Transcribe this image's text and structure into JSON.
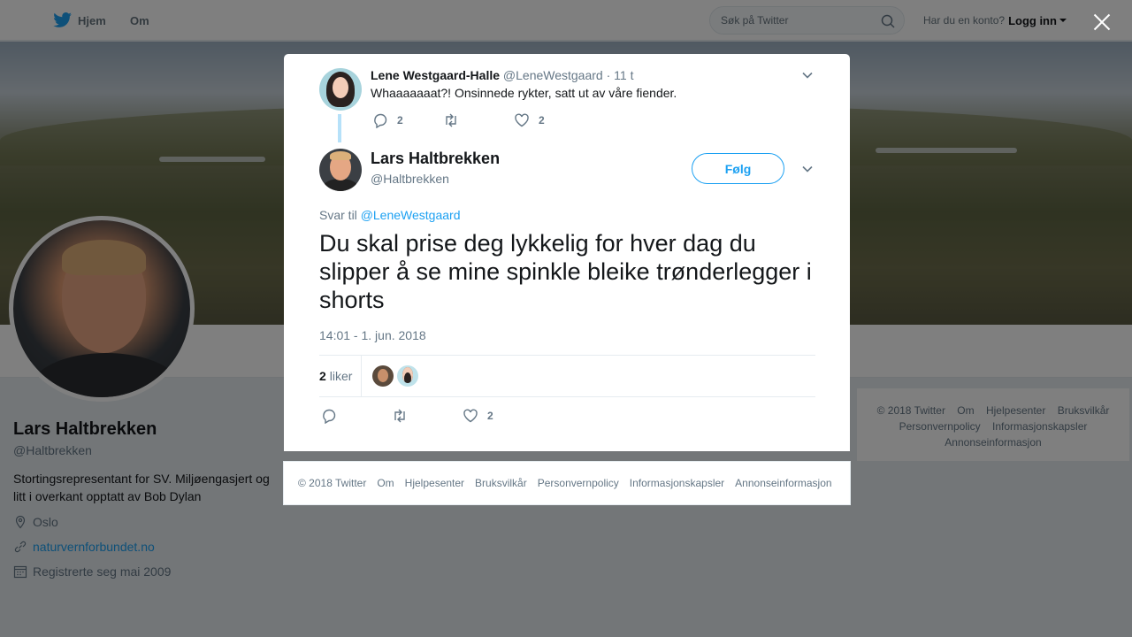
{
  "topnav": {
    "home_label": "Hjem",
    "about_label": "Om",
    "search_placeholder": "Søk på Twitter",
    "account_prompt": "Har du en konto?",
    "login_label": "Logg inn"
  },
  "profile": {
    "name": "Lars Haltbrekken",
    "handle": "@Haltbrekken",
    "bio": "Stortingsrepresentant for SV. Miljøengasjert og litt i overkant opptatt av Bob Dylan",
    "location": "Oslo",
    "website": "naturvernforbundet.no",
    "joined": "Registrerte seg mai 2009"
  },
  "right_footer": {
    "items": [
      "© 2018 Twitter",
      "Om",
      "Hjelpesenter",
      "Bruksvilkår",
      "Personvernpolicy",
      "Informasjonskapsler",
      "Annonseinformasjon"
    ]
  },
  "parent_tweet": {
    "name": "Lene Westgaard-Halle",
    "handle": "@LeneWestgaard",
    "time": "· 11 t",
    "text": "Whaaaaaaat?! Onsinnede rykter, satt ut av våre fiender.",
    "reply_count": "2",
    "retweet_count": "",
    "like_count": "2"
  },
  "main_tweet": {
    "name": "Lars Haltbrekken",
    "handle": "@Haltbrekken",
    "follow_label": "Følg",
    "reply_prefix": "Svar til",
    "reply_to": "@LeneWestgaard",
    "text": "Du skal prise deg lykkelig for hver dag du slipper å se mine spinkle bleike trønderlegger i shorts",
    "timestamp": "14:01 - 1. jun. 2018",
    "likes_count": "2",
    "likes_label": "liker",
    "reply_count": "",
    "retweet_count": "",
    "like_count": "2"
  },
  "modal_footer": {
    "items": [
      "© 2018 Twitter",
      "Om",
      "Hjelpesenter",
      "Bruksvilkår",
      "Personvernpolicy",
      "Informasjonskapsler",
      "Annonseinformasjon"
    ]
  },
  "colors": {
    "accent": "#1da1f2",
    "text": "#14171a",
    "muted": "#657786"
  }
}
